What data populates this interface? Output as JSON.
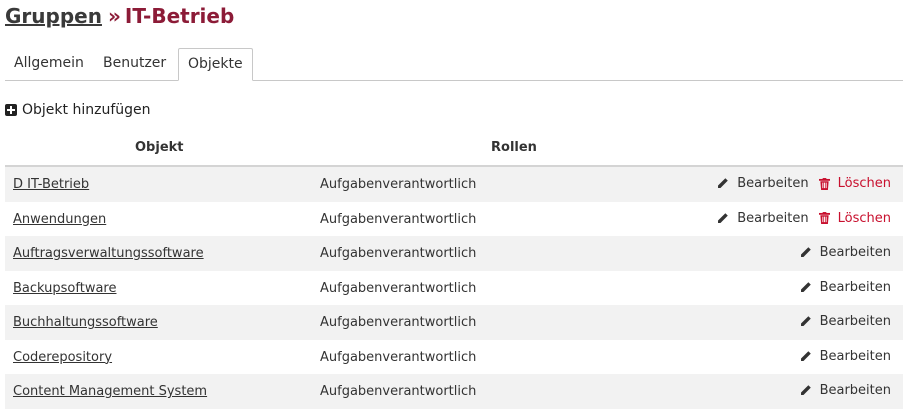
{
  "breadcrumb": {
    "parent": "Gruppen",
    "separator": "»",
    "current": "IT-Betrieb"
  },
  "tabs": [
    {
      "label": "Allgemein"
    },
    {
      "label": "Benutzer"
    },
    {
      "label": "Objekte",
      "active": true
    }
  ],
  "add_object": {
    "label": "Objekt hinzufügen",
    "icon": "plus-square-icon"
  },
  "table": {
    "headers": {
      "object": "Objekt",
      "roles": "Rollen"
    },
    "edit_label": "Bearbeiten",
    "delete_label": "Löschen",
    "rows": [
      {
        "object": "D IT-Betrieb",
        "role": "Aufgabenverantwortlich",
        "can_delete": true
      },
      {
        "object": "Anwendungen",
        "role": "Aufgabenverantwortlich",
        "can_delete": true
      },
      {
        "object": "Auftragsverwaltungssoftware",
        "role": "Aufgabenverantwortlich",
        "can_delete": false
      },
      {
        "object": "Backupsoftware",
        "role": "Aufgabenverantwortlich",
        "can_delete": false
      },
      {
        "object": "Buchhaltungssoftware",
        "role": "Aufgabenverantwortlich",
        "can_delete": false
      },
      {
        "object": "Coderepository",
        "role": "Aufgabenverantwortlich",
        "can_delete": false
      },
      {
        "object": "Content Management System",
        "role": "Aufgabenverantwortlich",
        "can_delete": false
      }
    ]
  },
  "colors": {
    "accent": "#8c1b37",
    "delete": "#c8102e",
    "row_alt": "#f2f2f2"
  }
}
